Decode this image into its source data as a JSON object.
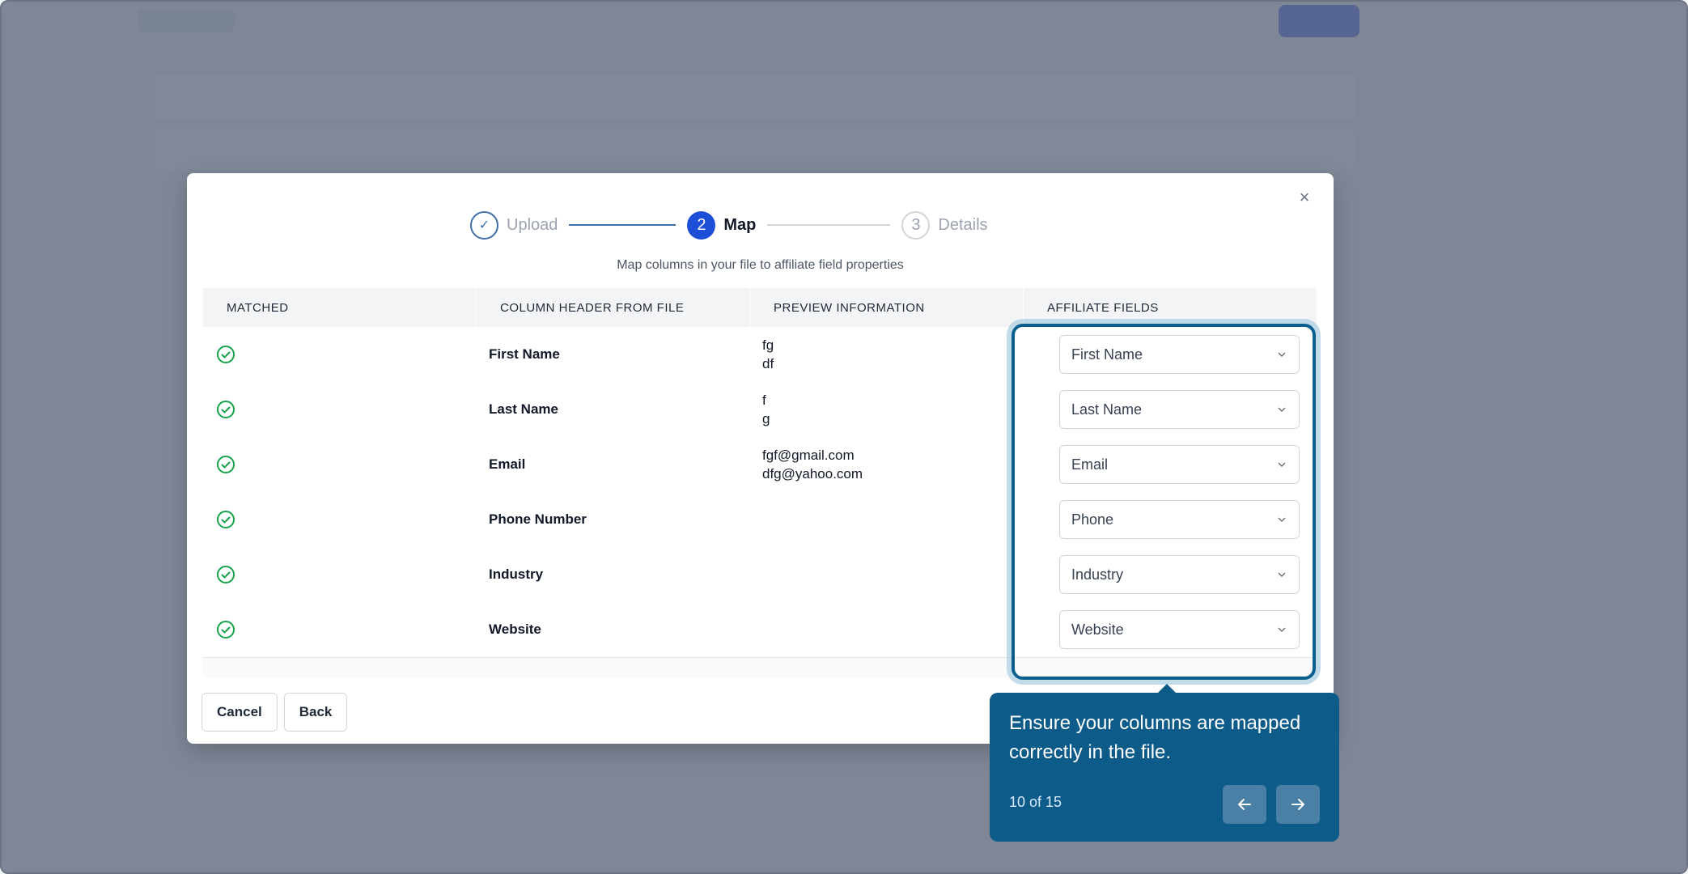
{
  "stepper": {
    "steps": [
      {
        "number": "✓",
        "label": "Upload",
        "state": "done"
      },
      {
        "number": "2",
        "label": "Map",
        "state": "active"
      },
      {
        "number": "3",
        "label": "Details",
        "state": "pending"
      }
    ]
  },
  "subtitle": "Map columns in your file to affiliate field properties",
  "table": {
    "headers": [
      "MATCHED",
      "COLUMN HEADER FROM FILE",
      "PREVIEW INFORMATION",
      "AFFILIATE FIELDS"
    ],
    "rows": [
      {
        "column": "First Name",
        "preview": [
          "fg",
          "df"
        ],
        "field": "First Name"
      },
      {
        "column": "Last Name",
        "preview": [
          "f",
          "g"
        ],
        "field": "Last Name"
      },
      {
        "column": "Email",
        "preview": [
          "fgf@gmail.com",
          "dfg@yahoo.com"
        ],
        "field": "Email"
      },
      {
        "column": "Phone Number",
        "preview": [
          "",
          ""
        ],
        "field": "Phone"
      },
      {
        "column": "Industry",
        "preview": [
          "",
          ""
        ],
        "field": "Industry"
      },
      {
        "column": "Website",
        "preview": [
          "",
          ""
        ],
        "field": "Website"
      }
    ]
  },
  "footer": {
    "cancel": "Cancel",
    "back": "Back"
  },
  "close": "×",
  "tooltip": {
    "text": "Ensure your columns are mapped correctly in the file.",
    "count": "10 of 15"
  },
  "colors": {
    "accent": "#1d4ed8",
    "tooltip": "#0c5b89",
    "success": "#16a34a"
  }
}
